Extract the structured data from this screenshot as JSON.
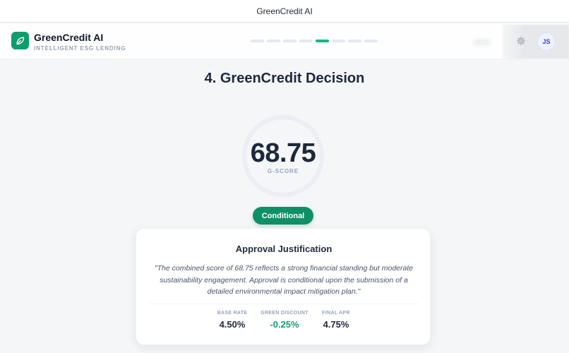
{
  "window": {
    "title": "GreenCredit AI"
  },
  "brand": {
    "name": "GreenCredit AI",
    "tagline": "INTELLIGENT ESG LENDING"
  },
  "progress": {
    "total_steps": 8,
    "active_step": 5
  },
  "user": {
    "initials": "JS"
  },
  "page": {
    "title": "4. GreenCredit Decision"
  },
  "score": {
    "value": "68.75",
    "label": "G-SCORE"
  },
  "decision": {
    "status": "Conditional"
  },
  "justification": {
    "title": "Approval Justification",
    "quote": "\"The combined score of 68.75 reflects a strong financial standing but moderate sustainability engagement. Approval is conditional upon the submission of a detailed environmental impact mitigation plan.\""
  },
  "metrics": [
    {
      "label": "BASE RATE",
      "value": "4.50%"
    },
    {
      "label": "GREEN DISCOUNT",
      "value": "-0.25%"
    },
    {
      "label": "FINAL APR",
      "value": "4.75%"
    }
  ],
  "colors": {
    "brand": "#0f9d6e",
    "accent_green": "#10b981",
    "text": "#1e293b",
    "muted": "#94a3b8"
  },
  "icons": {
    "logo": "leaf-icon",
    "settings": "gear-icon"
  }
}
